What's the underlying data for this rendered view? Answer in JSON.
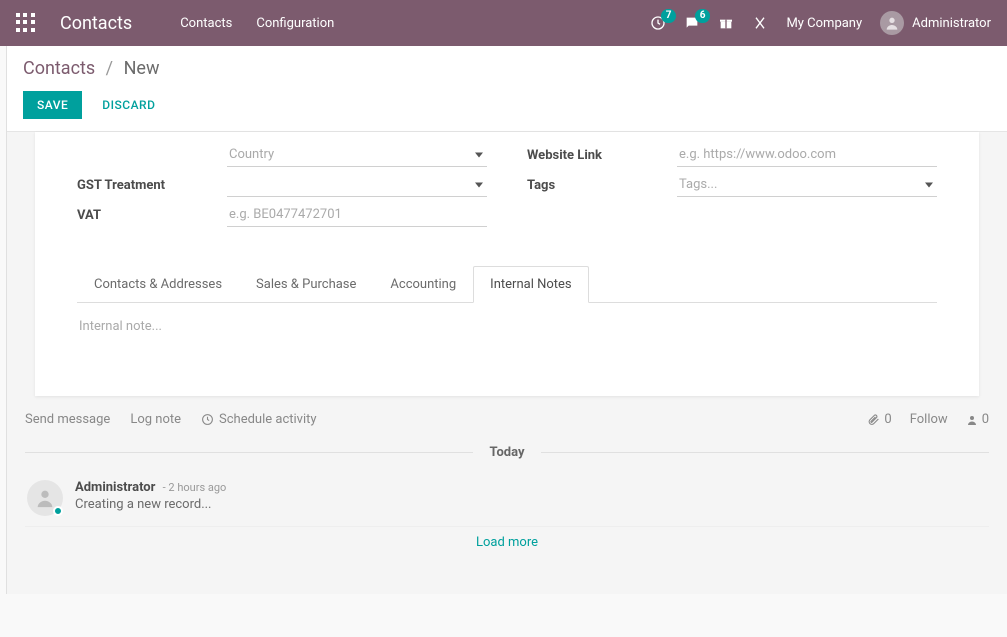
{
  "topbar": {
    "brand": "Contacts",
    "nav": {
      "contacts": "Contacts",
      "configuration": "Configuration"
    },
    "activities_badge": "7",
    "messages_badge": "6",
    "company": "My Company",
    "user": "Administrator"
  },
  "breadcrumb": {
    "root": "Contacts",
    "sep": "/",
    "current": "New"
  },
  "actions": {
    "save": "SAVE",
    "discard": "DISCARD"
  },
  "form": {
    "country_label": "",
    "country_placeholder": "Country",
    "gst_label": "GST Treatment",
    "vat_label": "VAT",
    "vat_placeholder": "e.g. BE0477472701",
    "website_label": "Website Link",
    "website_placeholder": "e.g. https://www.odoo.com",
    "tags_label": "Tags",
    "tags_placeholder": "Tags..."
  },
  "tabs": {
    "contacts": "Contacts & Addresses",
    "sales": "Sales & Purchase",
    "accounting": "Accounting",
    "notes": "Internal Notes"
  },
  "notes_placeholder": "Internal note...",
  "chatter": {
    "send": "Send message",
    "log": "Log note",
    "schedule": "Schedule activity",
    "follow": "Follow",
    "attach_count": "0",
    "follower_count": "0",
    "today": "Today",
    "msg_author": "Administrator",
    "msg_time": "- 2 hours ago",
    "msg_text": "Creating a new record...",
    "load_more": "Load more"
  }
}
